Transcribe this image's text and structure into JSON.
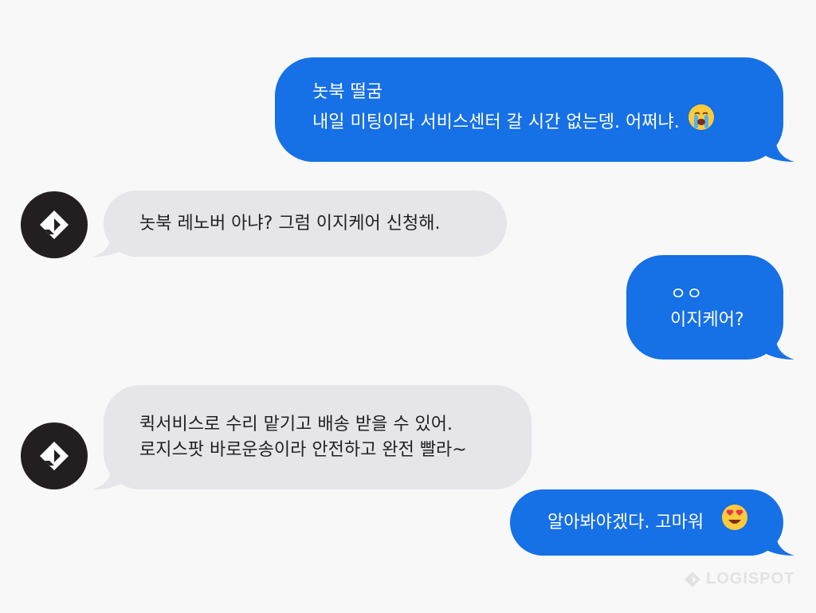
{
  "messages": [
    {
      "side": "sent",
      "lines": [
        "놋북 떨굼",
        "내일 미팅이라 서비스센터 갈 시간 없는뎅. 어쩌냐."
      ],
      "emoji": "crying-face-icon"
    },
    {
      "side": "received",
      "lines": [
        "놋북 레노버 아냐? 그럼 이지케어 신청해."
      ]
    },
    {
      "side": "sent",
      "lines": [
        "ㅇㅇ",
        "이지케어?"
      ]
    },
    {
      "side": "received",
      "lines": [
        "퀵서비스로 수리 맡기고 배송 받을 수 있어.",
        "로지스팟 바로운송이라 안전하고 완전 빨라~"
      ]
    },
    {
      "side": "sent",
      "lines": [
        "알아봐야겠다. 고마워"
      ],
      "emoji": "heart-eyes-face-icon"
    }
  ],
  "avatar": {
    "icon": "logispot-logo-icon",
    "background": "#231f20"
  },
  "watermark": {
    "text": "LOGISPOT"
  },
  "colors": {
    "sent_bubble": "#1670e6",
    "received_bubble": "#e5e5ea",
    "background": "#f8f8f8"
  }
}
